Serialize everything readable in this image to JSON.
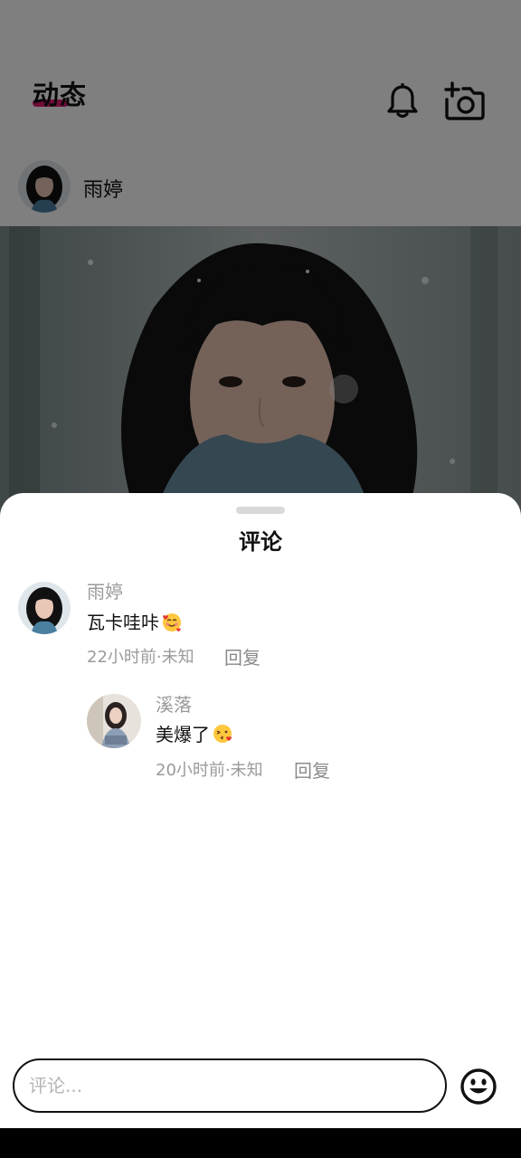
{
  "header": {
    "title": "动态",
    "accent_color": "#e11d74"
  },
  "post": {
    "author": "雨婷"
  },
  "comments_sheet": {
    "title": "评论",
    "comments": [
      {
        "name": "雨婷",
        "text": "瓦卡哇咔",
        "emoji": "smiling-face-with-hearts",
        "meta": "22小时前·未知",
        "reply_label": "回复"
      },
      {
        "name": "溪落",
        "text": "美爆了",
        "emoji": "face-blowing-kiss",
        "meta": "20小时前·未知",
        "reply_label": "回复"
      }
    ],
    "input": {
      "placeholder": "评论...",
      "value": ""
    }
  },
  "icons": {
    "bell": "bell-icon",
    "camera": "camera-add-icon",
    "emoji": "emoji-smile-icon"
  },
  "colors": {
    "overlay": "rgba(0,0,0,0.5)",
    "secondary_text": "#9a9a9a"
  }
}
